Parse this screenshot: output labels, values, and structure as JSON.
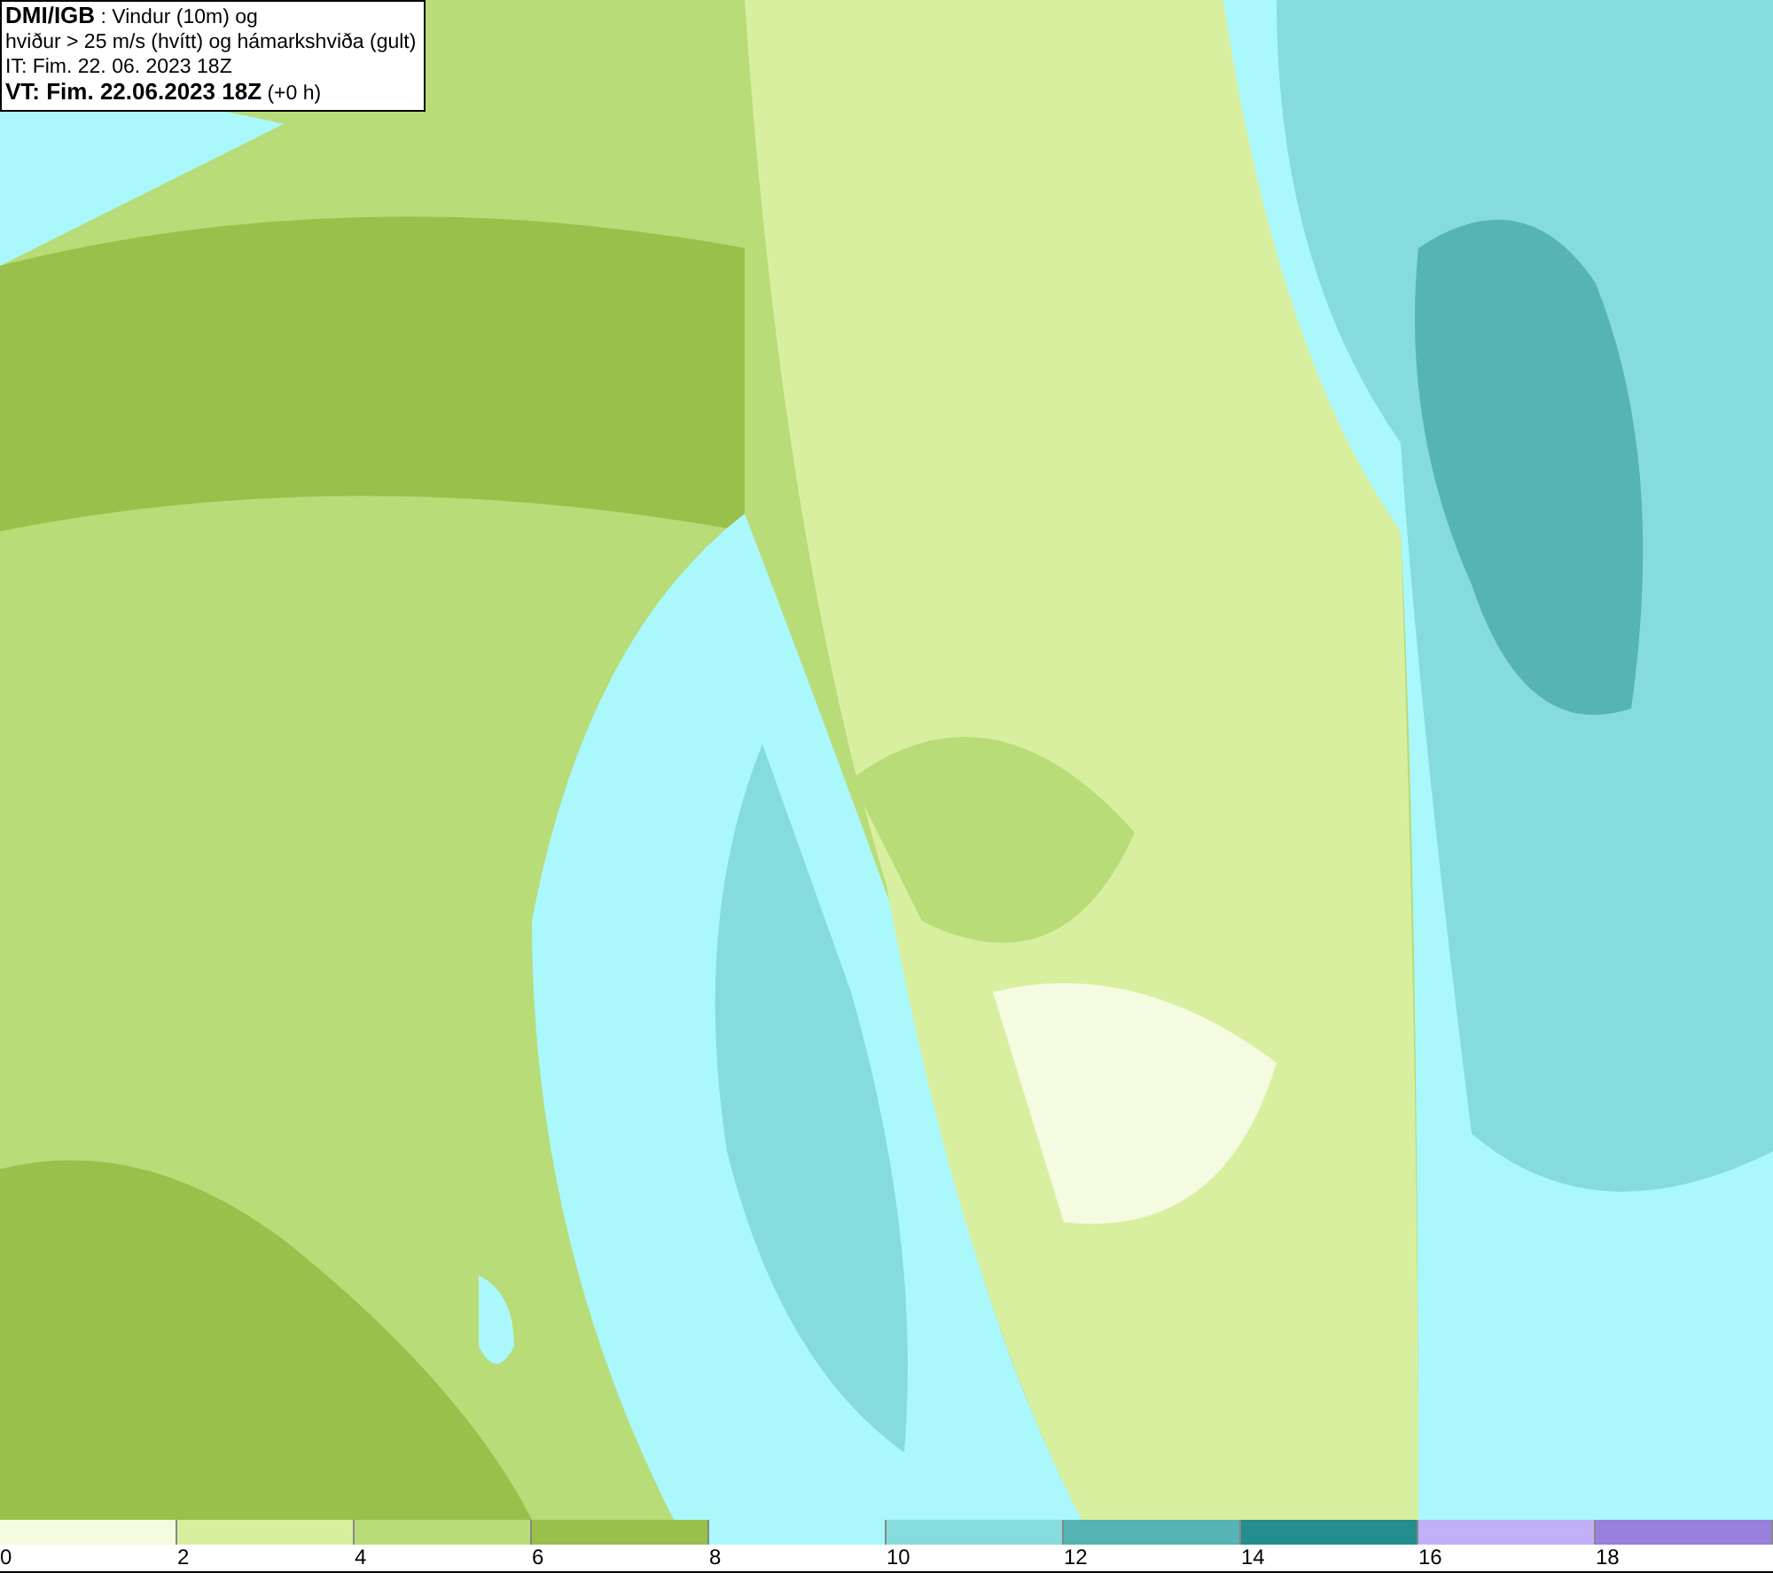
{
  "header": {
    "lines": [
      "**DMI/IGB** : Vindur (10m) og",
      "hviður > 25 m/s (hvítt) og hámarkshviða (gult)",
      "IT: Fim. 22. 06. 2023 18Z",
      "**VT: Fim. 22.06.2023 18Z** (+0 h)"
    ]
  },
  "legend": [
    {
      "label": "0",
      "color": "#f4fbe0"
    },
    {
      "label": "2",
      "color": "#d8efa0"
    },
    {
      "label": "4",
      "color": "#b8dc78"
    },
    {
      "label": "6",
      "color": "#98c04a"
    },
    {
      "label": "8",
      "color": "#aaf8fc"
    },
    {
      "label": "10",
      "color": "#86dcdc"
    },
    {
      "label": "12",
      "color": "#56b4b4"
    },
    {
      "label": "14",
      "color": "#248e8e"
    },
    {
      "label": "16",
      "color": "#c0b0f8"
    },
    {
      "label": "18",
      "color": "#9880dc"
    }
  ]
}
